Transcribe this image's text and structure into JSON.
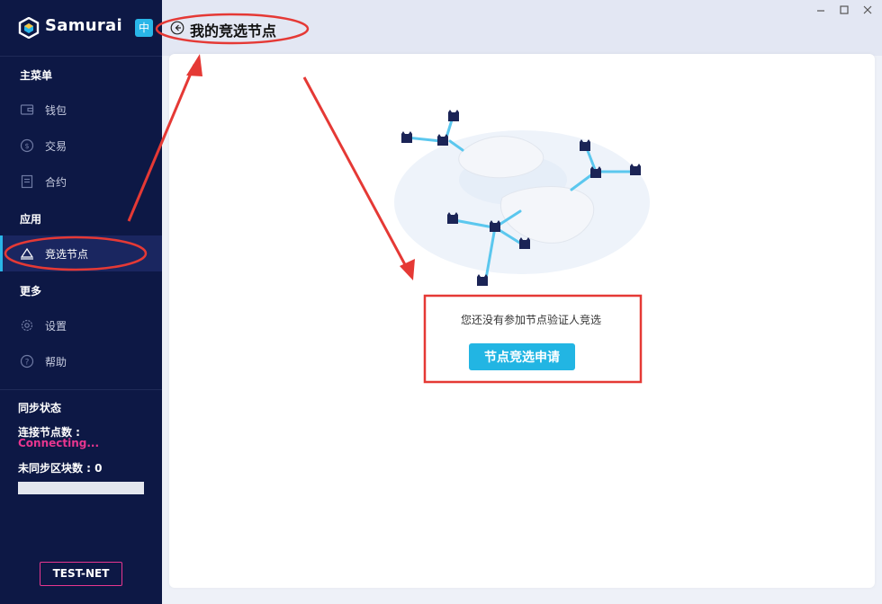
{
  "app": {
    "name": "Samurai",
    "lang_badge": "中"
  },
  "sidebar": {
    "main_menu": "主菜单",
    "items_main": [
      {
        "label": "钱包",
        "icon": "wallet-icon"
      },
      {
        "label": "交易",
        "icon": "exchange-icon"
      },
      {
        "label": "合约",
        "icon": "contract-icon"
      }
    ],
    "apps": "应用",
    "items_apps": [
      {
        "label": "竞选节点",
        "icon": "node-election-icon"
      }
    ],
    "more": "更多",
    "items_more": [
      {
        "label": "设置",
        "icon": "gear-icon"
      },
      {
        "label": "帮助",
        "icon": "help-icon"
      }
    ]
  },
  "sync": {
    "title": "同步状态",
    "nodes_label": "连接节点数 :",
    "nodes_value": "Connecting...",
    "blocks_label": "未同步区块数 : 0",
    "progress": 0
  },
  "network": "TEST-NET",
  "header": {
    "title": "我的竞选节点"
  },
  "main": {
    "empty_message": "您还没有参加节点验证人竞选",
    "apply_button": "节点竞选申请"
  },
  "colors": {
    "sidebar_bg": "#0d1845",
    "accent": "#29b6e8",
    "pink": "#e8368f",
    "annotation_red": "#e53935"
  }
}
